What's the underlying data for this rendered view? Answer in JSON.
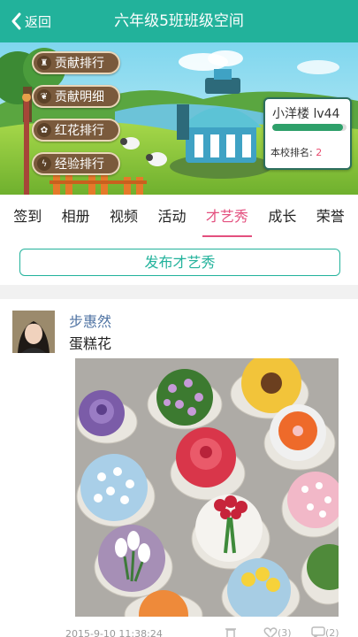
{
  "header": {
    "back_label": "返回",
    "title": "六年级5班班级空间"
  },
  "banner": {
    "menu": [
      {
        "label": "贡献排行",
        "icon": "medal-icon",
        "icon_char": "♜"
      },
      {
        "label": "贡献明细",
        "icon": "leaf-icon",
        "icon_char": "❦"
      },
      {
        "label": "红花排行",
        "icon": "flower-icon",
        "icon_char": "✿"
      },
      {
        "label": "经验排行",
        "icon": "lightning-icon",
        "icon_char": "ϟ"
      }
    ],
    "card": {
      "name": "小洋楼 lv44",
      "progress": 0.95,
      "rank_label": "本校排名:",
      "rank_value": "2"
    }
  },
  "tabs": [
    {
      "label": "签到",
      "active": false
    },
    {
      "label": "相册",
      "active": false
    },
    {
      "label": "视频",
      "active": false
    },
    {
      "label": "活动",
      "active": false
    },
    {
      "label": "才艺秀",
      "active": true
    },
    {
      "label": "成长",
      "active": false
    },
    {
      "label": "荣誉",
      "active": false
    }
  ],
  "publish_label": "发布才艺秀",
  "post": {
    "author": "步惠然",
    "text": "蛋糕花",
    "time": "2015-9-10 11:38:24",
    "like_count": "(3)",
    "comment_count": "(2)"
  },
  "colors": {
    "accent": "#22b29b",
    "active_tab": "#e34f7e",
    "author": "#4f73a3"
  }
}
